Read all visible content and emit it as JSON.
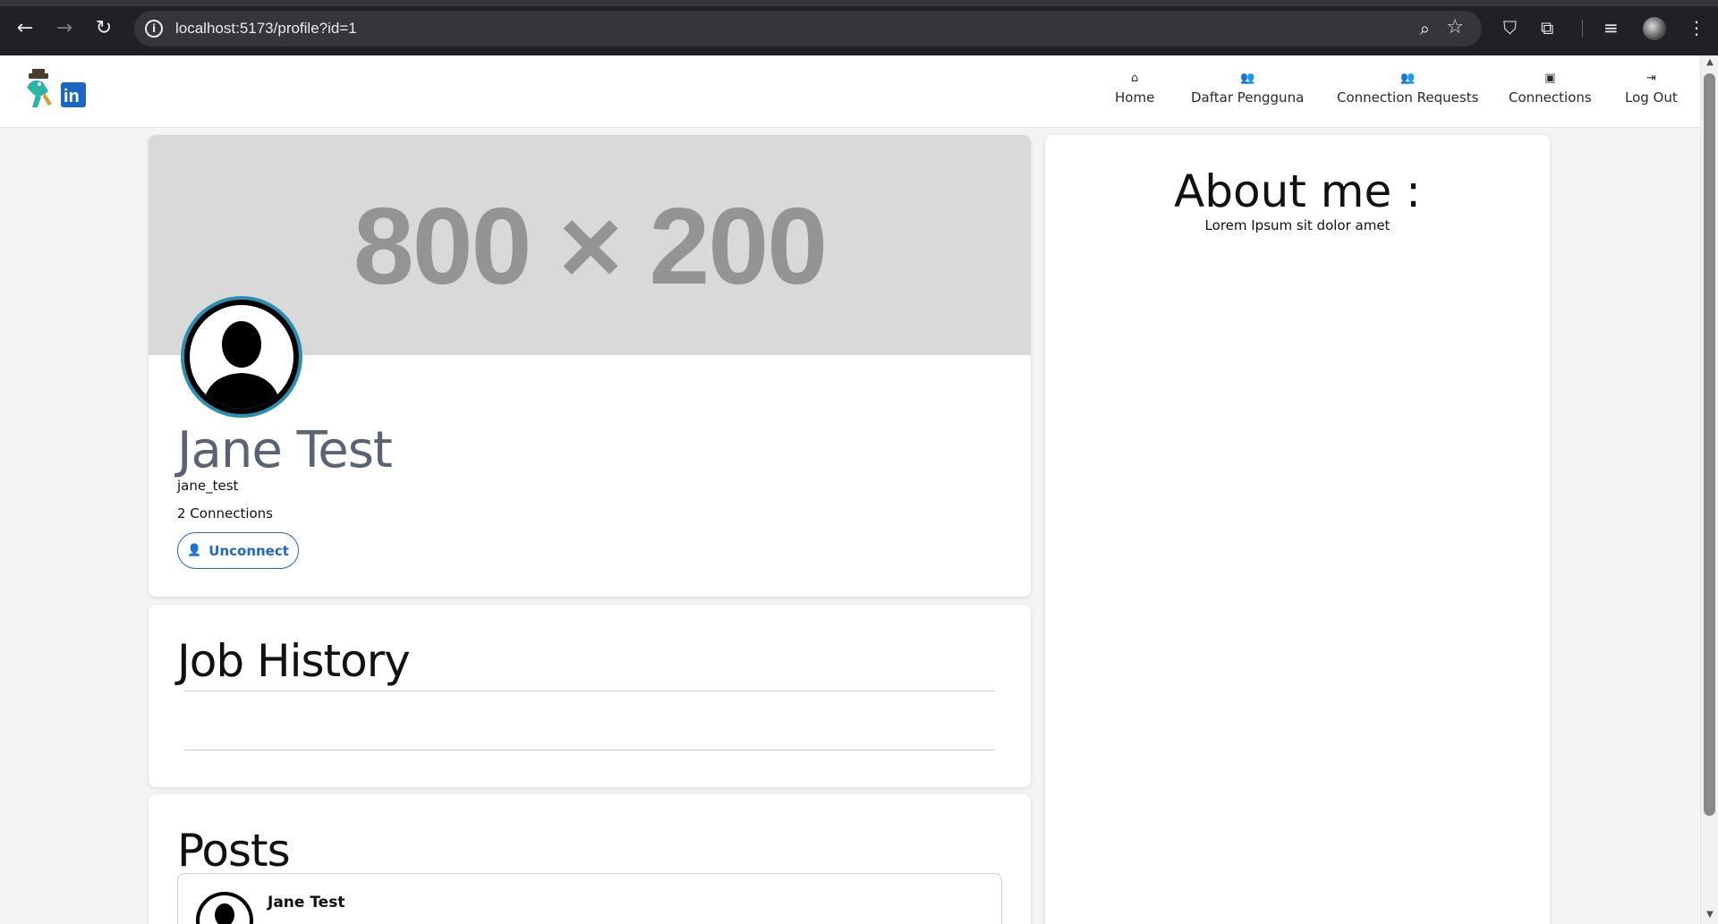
{
  "browser": {
    "url": "localhost:5173/profile?id=1",
    "back_icon": "arrow-left-icon",
    "forward_icon": "arrow-right-icon",
    "reload_icon": "reload-icon"
  },
  "nav": {
    "items": [
      {
        "label": "Home",
        "icon": "home-icon"
      },
      {
        "label": "Daftar Pengguna",
        "icon": "users-icon"
      },
      {
        "label": "Connection Requests",
        "icon": "user-friends-icon"
      },
      {
        "label": "Connections",
        "icon": "briefcase-icon"
      },
      {
        "label": "Log Out",
        "icon": "sign-out-icon"
      }
    ]
  },
  "profile": {
    "banner_text": "800 × 200",
    "name": "Jane Test",
    "username": "jane_test",
    "connections": "2 Connections",
    "unconnect_label": "Unconnect"
  },
  "job_history": {
    "title": "Job History"
  },
  "posts": {
    "title": "Posts",
    "items": [
      {
        "author": "Jane Test"
      }
    ]
  },
  "about": {
    "title": "About me :",
    "text": "Lorem Ipsum sit dolor amet"
  },
  "colors": {
    "accent": "#1e66d0",
    "avatar_ring": "#2a8fb0",
    "banner_bg": "#d9d9d9"
  }
}
